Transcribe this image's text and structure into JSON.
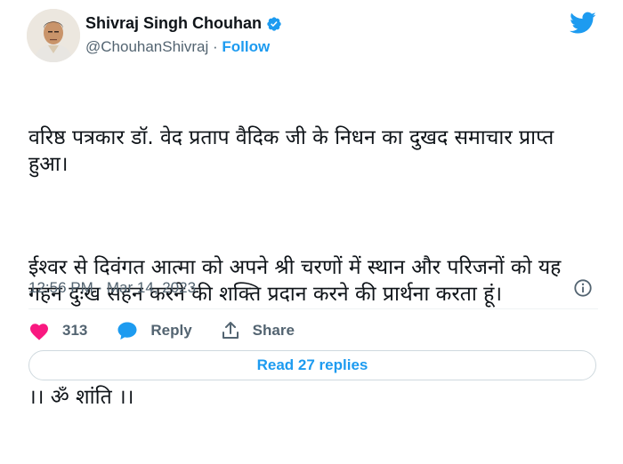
{
  "author": {
    "name": "Shivraj Singh Chouhan",
    "handle": "@ChouhanShivraj",
    "separator": "·",
    "follow_label": "Follow"
  },
  "tweet": {
    "paragraph1": "वरिष्ठ पत्रकार डॉ. वेद प्रताप वैदिक जी के निधन का दुखद समाचार प्राप्त हुआ।",
    "paragraph2": "ईश्वर से दिवंगत आत्मा को अपने श्री चरणों में स्थान और परिजनों को यह गहन दुःख सहन करने की शक्ति प्रदान करने की प्रार्थना करता हूं।",
    "paragraph3": "।। ॐ शांति ।।",
    "timestamp": "12:56 PM · Mar 14, 2023"
  },
  "actions": {
    "like_count": "313",
    "reply_label": "Reply",
    "share_label": "Share"
  },
  "read_replies_label": "Read 27 replies",
  "icons": {
    "avatar": "avatar",
    "verified": "verified-badge-icon",
    "brand": "twitter-bird-icon",
    "info": "info-icon",
    "like": "heart-icon",
    "reply": "comment-bubble-icon",
    "share": "share-upload-icon"
  },
  "colors": {
    "accent": "#1d9bf0",
    "like": "#f91880",
    "text": "#0f1419",
    "muted": "#536471"
  }
}
